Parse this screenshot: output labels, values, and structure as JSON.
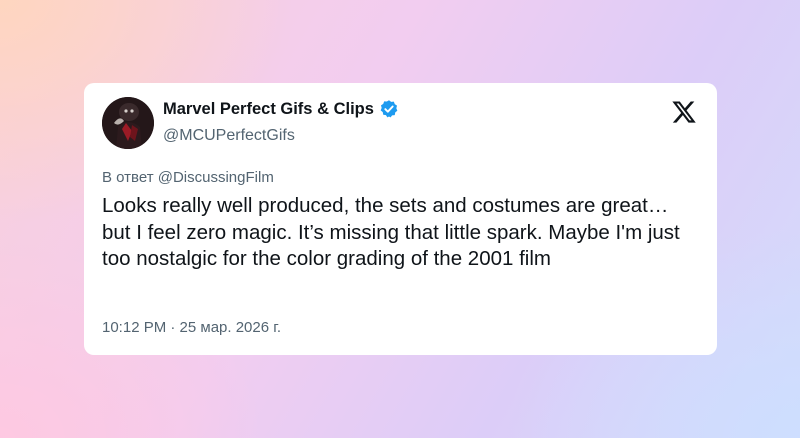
{
  "tweet": {
    "display_name": "Marvel Perfect Gifs & Clips",
    "handle": "@MCUPerfectGifs",
    "reply_to": "В ответ @DiscussingFilm",
    "text": "Looks really well produced, the sets and costumes are great… but I feel zero magic. It’s missing that little spark. Maybe I'm just too nostalgic for the color grading of the 2001 film",
    "timestamp": "10:12 PM · 25 мар. 2026 г."
  },
  "icons": {
    "verified": "verified-badge-icon",
    "platform": "x-logo-icon"
  },
  "colors": {
    "verified": "#1d9bf0",
    "text": "#0f1419",
    "secondary_text": "#536471",
    "card_background": "#ffffff"
  }
}
